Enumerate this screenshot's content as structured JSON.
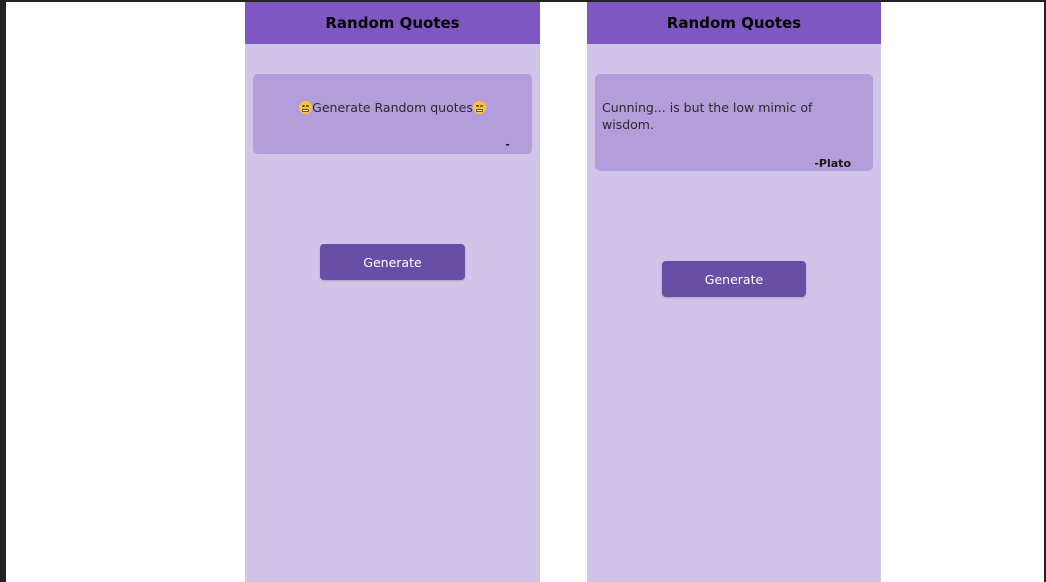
{
  "screens": [
    {
      "app_bar": {
        "title": "Random Quotes"
      },
      "quote": {
        "leading_emoji": "grinning-face-icon",
        "text": "Generate Random quotes",
        "trailing_emoji": "grinning-face-icon",
        "author": "-"
      },
      "generate_button": {
        "label": "Generate"
      }
    },
    {
      "app_bar": {
        "title": "Random Quotes"
      },
      "quote": {
        "text": "Cunning... is but the low mimic of wisdom.",
        "author": "-Plato"
      },
      "generate_button": {
        "label": "Generate"
      }
    }
  ],
  "colors": {
    "app_bar": "#7e57c2",
    "screen_background": "#d1c4e9",
    "card_background": "#b39ddb",
    "button_background": "#674ea7",
    "button_text": "#ffffff"
  }
}
